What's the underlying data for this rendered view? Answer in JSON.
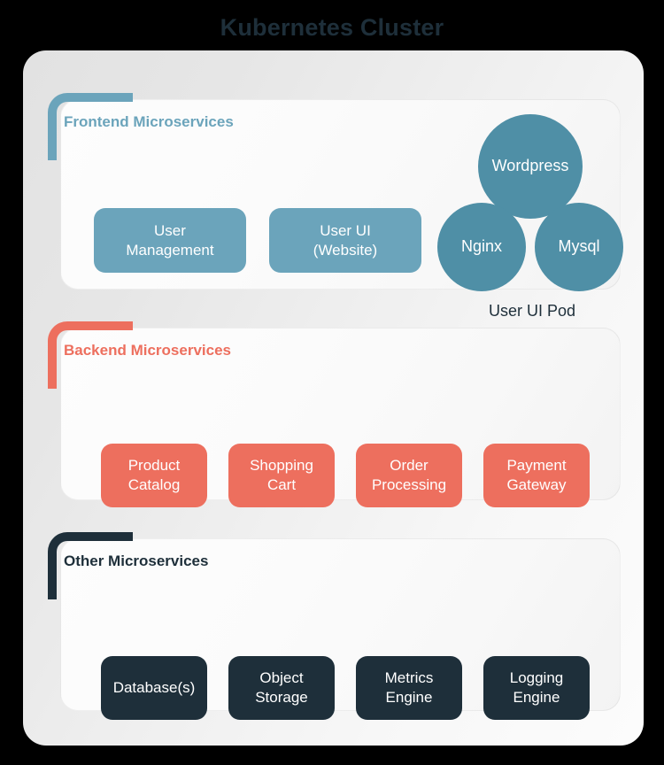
{
  "title": "Kubernetes Cluster",
  "colors": {
    "background": "#000000",
    "title_text": "#1e2f3a",
    "shell_bg": "#ececec",
    "card_bg": "#fbfbfb",
    "frontend_accent": "#6ba4bb",
    "backend_accent": "#ed6f5e",
    "other_accent": "#1e2f3a",
    "pod_circle": "#4f8fa6",
    "box_text": "#ffffff"
  },
  "sections": {
    "frontend": {
      "label": "Frontend Microservices",
      "accent": "#6ba4bb",
      "services": [
        {
          "name": "User\nManagement"
        },
        {
          "name": "User UI\n(Website)"
        }
      ]
    },
    "backend": {
      "label": "Backend Microservices",
      "accent": "#ed6f5e",
      "services": [
        {
          "name": "Product\nCatalog"
        },
        {
          "name": "Shopping\nCart"
        },
        {
          "name": "Order\nProcessing"
        },
        {
          "name": "Payment\nGateway"
        }
      ]
    },
    "other": {
      "label": "Other Microservices",
      "accent": "#1e2f3a",
      "services": [
        {
          "name": "Database(s)"
        },
        {
          "name": "Object\nStorage"
        },
        {
          "name": "Metrics\nEngine"
        },
        {
          "name": "Logging\nEngine"
        }
      ]
    }
  },
  "pod": {
    "caption": "User UI Pod",
    "circles": [
      {
        "name": "Wordpress",
        "size": "large"
      },
      {
        "name": "Nginx",
        "size": "small"
      },
      {
        "name": "Mysql",
        "size": "small"
      }
    ]
  }
}
